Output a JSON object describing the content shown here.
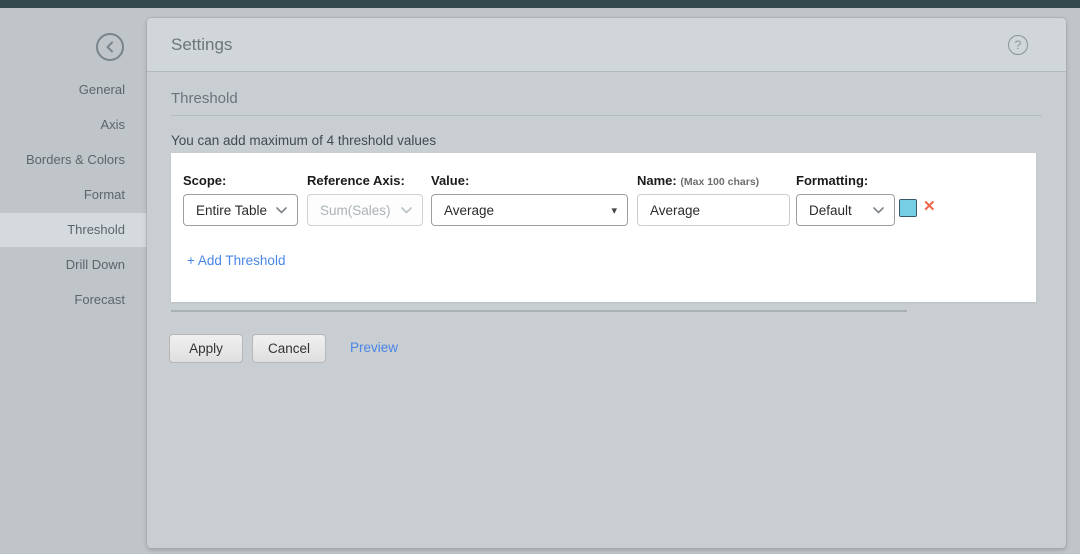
{
  "header": {
    "title": "Settings",
    "help": "?"
  },
  "sidebar": {
    "items": [
      {
        "label": "General"
      },
      {
        "label": "Axis"
      },
      {
        "label": "Borders & Colors"
      },
      {
        "label": "Format"
      },
      {
        "label": "Threshold",
        "selected": true
      },
      {
        "label": "Drill Down"
      },
      {
        "label": "Forecast"
      }
    ]
  },
  "section": {
    "title": "Threshold",
    "hint": "You can add maximum of 4 threshold values"
  },
  "form": {
    "scope": {
      "label": "Scope:",
      "value": "Entire Table"
    },
    "reference_axis": {
      "label": "Reference Axis:",
      "value": "Sum(Sales)",
      "disabled": true
    },
    "value": {
      "label": "Value:",
      "value": "Average"
    },
    "name": {
      "label": "Name:",
      "sublabel": "(Max 100 chars)",
      "value": "Average"
    },
    "formatting": {
      "label": "Formatting:",
      "value": "Default"
    },
    "delete_icon": "✕",
    "add_label": "+ Add Threshold"
  },
  "actions": {
    "apply": "Apply",
    "cancel": "Cancel",
    "preview": "Preview"
  },
  "colors": {
    "topbar": "#33494e",
    "page_bg": "#bfc5c8",
    "panel_bg": "#c8ced1",
    "link_accent": "#4a86e8",
    "swatch": "#77cfe5",
    "delete_x": "#f2664d",
    "selected_item_bg": "#d4dadd"
  }
}
